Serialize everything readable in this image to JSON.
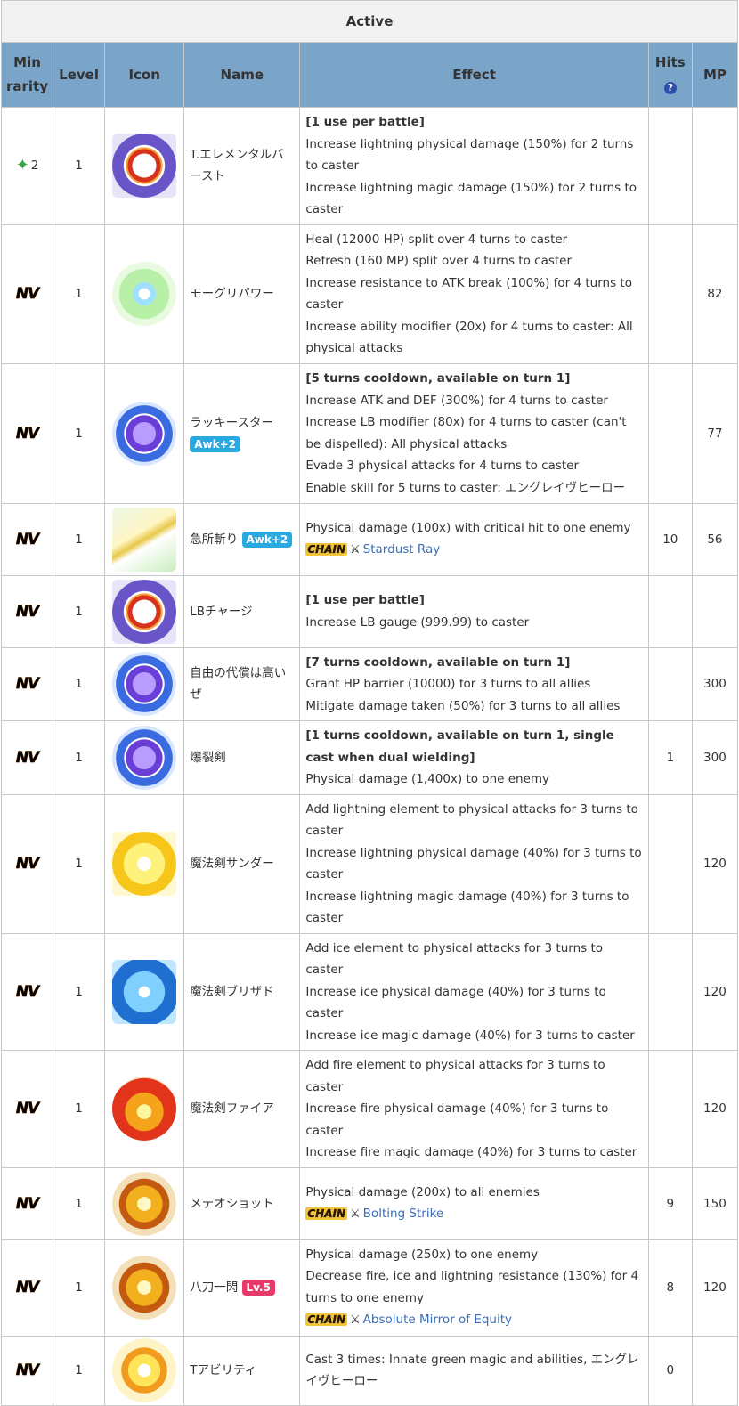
{
  "table_title": "Active",
  "headers": {
    "min_rarity": "Min rarity",
    "level": "Level",
    "icon": "Icon",
    "name": "Name",
    "effect": "Effect",
    "hits": "Hits",
    "hits_help": "?",
    "mp": "MP"
  },
  "rows": [
    {
      "rarity": "2",
      "level": "1",
      "icon": "ring-orange-icon",
      "name": "T.エレメンタルバースト",
      "effect": [
        "[1 use per battle]",
        "Increase lightning physical damage (150%) for 2 turns to caster",
        "Increase lightning magic damage (150%) for 2 turns to caster"
      ],
      "hits": "",
      "mp": ""
    },
    {
      "rarity": "NV",
      "level": "1",
      "icon": "green-orb-icon",
      "name": "モーグリパワー",
      "effect": [
        "Heal (12000 HP) split over 4 turns to caster",
        "Refresh (160 MP) split over 4 turns to caster",
        "Increase resistance to ATK break (100%) for 4 turns to caster",
        "Increase ability modifier (20x) for 4 turns to caster: All physical attacks"
      ],
      "hits": "",
      "mp": "82"
    },
    {
      "rarity": "NV",
      "level": "1",
      "icon": "purple-orb-icon",
      "name": "ラッキースター",
      "badge": "Awk+2",
      "effect": [
        "[5 turns cooldown, available on turn 1]",
        "Increase ATK and DEF (300%) for 4 turns to caster",
        "Increase LB modifier (80x) for 4 turns to caster (can't be dispelled): All physical attacks",
        "Evade 3 physical attacks for 4 turns to caster",
        "Enable skill for 5 turns to caster: エングレイヴヒーロー"
      ],
      "hits": "",
      "mp": "77"
    },
    {
      "rarity": "NV",
      "level": "1",
      "icon": "sword-icon",
      "name": "急所斬り",
      "badge": "Awk+2",
      "effect": [
        "Physical damage (100x) with critical hit to one enemy"
      ],
      "chain_label": "CHAIN",
      "chain_link": "Stardust Ray",
      "hits": "10",
      "mp": "56"
    },
    {
      "rarity": "NV",
      "level": "1",
      "icon": "ring-orange-icon",
      "name": "LBチャージ",
      "effect": [
        "[1 use per battle]",
        "Increase LB gauge (999.99) to caster"
      ],
      "hits": "",
      "mp": ""
    },
    {
      "rarity": "NV",
      "level": "1",
      "icon": "purple-orb-icon",
      "name": "自由の代償は高いぜ",
      "effect": [
        "[7 turns cooldown, available on turn 1]",
        "Grant HP barrier (10000) for 3 turns to all allies",
        "Mitigate damage taken (50%) for 3 turns to all allies"
      ],
      "hits": "",
      "mp": "300"
    },
    {
      "rarity": "NV",
      "level": "1",
      "icon": "purple-orb-icon",
      "name": "爆裂剣",
      "effect": [
        "[1 turns cooldown, available on turn 1, single cast when dual wielding]",
        "Physical damage (1,400x) to one enemy"
      ],
      "hits": "1",
      "mp": "300"
    },
    {
      "rarity": "NV",
      "level": "1",
      "icon": "thunder-icon",
      "name": "魔法剣サンダー",
      "effect": [
        "Add lightning element to physical attacks for 3 turns to caster",
        "Increase lightning physical damage (40%) for 3 turns to caster",
        "Increase lightning magic damage (40%) for 3 turns to caster"
      ],
      "hits": "",
      "mp": "120"
    },
    {
      "rarity": "NV",
      "level": "1",
      "icon": "ice-icon",
      "name": "魔法剣ブリザド",
      "effect": [
        "Add ice element to physical attacks for 3 turns to caster",
        "Increase ice physical damage (40%) for 3 turns to caster",
        "Increase ice magic damage (40%) for 3 turns to caster"
      ],
      "hits": "",
      "mp": "120"
    },
    {
      "rarity": "NV",
      "level": "1",
      "icon": "fire-icon",
      "name": "魔法剣ファイア",
      "effect": [
        "Add fire element to physical attacks for 3 turns to caster",
        "Increase fire physical damage (40%) for 3 turns to caster",
        "Increase fire magic damage (40%) for 3 turns to caster"
      ],
      "hits": "",
      "mp": "120"
    },
    {
      "rarity": "NV",
      "level": "1",
      "icon": "burst-icon",
      "name": "メテオショット",
      "effect": [
        "Physical damage (200x) to all enemies"
      ],
      "chain_label": "CHAIN",
      "chain_link": "Bolting Strike",
      "hits": "9",
      "mp": "150"
    },
    {
      "rarity": "NV",
      "level": "1",
      "icon": "burst-icon",
      "name": "八刀一閃",
      "badge_lv": "Lv.5",
      "effect": [
        "Physical damage (250x) to one enemy",
        "Decrease fire, ice and lightning resistance (130%) for 4 turns to one enemy"
      ],
      "chain_label": "CHAIN",
      "chain_link": "Absolute Mirror of Equity",
      "hits": "8",
      "mp": "120"
    },
    {
      "rarity": "NV",
      "level": "1",
      "icon": "star-burst-icon",
      "name": "Tアビリティ",
      "effect": [
        "Cast 3 times: Innate green magic and abilities, エングレイヴヒーロー"
      ],
      "hits": "0",
      "mp": ""
    }
  ]
}
